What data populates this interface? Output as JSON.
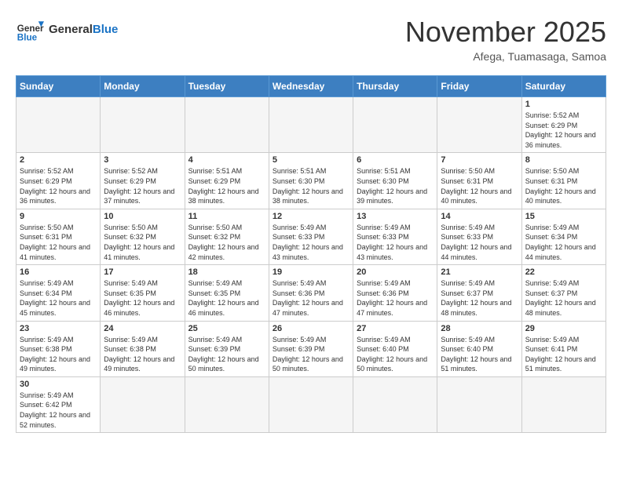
{
  "header": {
    "logo_general": "General",
    "logo_blue": "Blue",
    "month_title": "November 2025",
    "location": "Afega, Tuamasaga, Samoa"
  },
  "weekdays": [
    "Sunday",
    "Monday",
    "Tuesday",
    "Wednesday",
    "Thursday",
    "Friday",
    "Saturday"
  ],
  "weeks": [
    [
      {
        "day": "",
        "empty": true
      },
      {
        "day": "",
        "empty": true
      },
      {
        "day": "",
        "empty": true
      },
      {
        "day": "",
        "empty": true
      },
      {
        "day": "",
        "empty": true
      },
      {
        "day": "",
        "empty": true
      },
      {
        "day": "1",
        "sunrise": "5:52 AM",
        "sunset": "6:29 PM",
        "daylight": "12 hours and 36 minutes."
      }
    ],
    [
      {
        "day": "2",
        "sunrise": "5:52 AM",
        "sunset": "6:29 PM",
        "daylight": "12 hours and 36 minutes."
      },
      {
        "day": "3",
        "sunrise": "5:52 AM",
        "sunset": "6:29 PM",
        "daylight": "12 hours and 37 minutes."
      },
      {
        "day": "4",
        "sunrise": "5:51 AM",
        "sunset": "6:29 PM",
        "daylight": "12 hours and 38 minutes."
      },
      {
        "day": "5",
        "sunrise": "5:51 AM",
        "sunset": "6:30 PM",
        "daylight": "12 hours and 38 minutes."
      },
      {
        "day": "6",
        "sunrise": "5:51 AM",
        "sunset": "6:30 PM",
        "daylight": "12 hours and 39 minutes."
      },
      {
        "day": "7",
        "sunrise": "5:50 AM",
        "sunset": "6:31 PM",
        "daylight": "12 hours and 40 minutes."
      },
      {
        "day": "8",
        "sunrise": "5:50 AM",
        "sunset": "6:31 PM",
        "daylight": "12 hours and 40 minutes."
      }
    ],
    [
      {
        "day": "9",
        "sunrise": "5:50 AM",
        "sunset": "6:31 PM",
        "daylight": "12 hours and 41 minutes."
      },
      {
        "day": "10",
        "sunrise": "5:50 AM",
        "sunset": "6:32 PM",
        "daylight": "12 hours and 41 minutes."
      },
      {
        "day": "11",
        "sunrise": "5:50 AM",
        "sunset": "6:32 PM",
        "daylight": "12 hours and 42 minutes."
      },
      {
        "day": "12",
        "sunrise": "5:49 AM",
        "sunset": "6:33 PM",
        "daylight": "12 hours and 43 minutes."
      },
      {
        "day": "13",
        "sunrise": "5:49 AM",
        "sunset": "6:33 PM",
        "daylight": "12 hours and 43 minutes."
      },
      {
        "day": "14",
        "sunrise": "5:49 AM",
        "sunset": "6:33 PM",
        "daylight": "12 hours and 44 minutes."
      },
      {
        "day": "15",
        "sunrise": "5:49 AM",
        "sunset": "6:34 PM",
        "daylight": "12 hours and 44 minutes."
      }
    ],
    [
      {
        "day": "16",
        "sunrise": "5:49 AM",
        "sunset": "6:34 PM",
        "daylight": "12 hours and 45 minutes."
      },
      {
        "day": "17",
        "sunrise": "5:49 AM",
        "sunset": "6:35 PM",
        "daylight": "12 hours and 46 minutes."
      },
      {
        "day": "18",
        "sunrise": "5:49 AM",
        "sunset": "6:35 PM",
        "daylight": "12 hours and 46 minutes."
      },
      {
        "day": "19",
        "sunrise": "5:49 AM",
        "sunset": "6:36 PM",
        "daylight": "12 hours and 47 minutes."
      },
      {
        "day": "20",
        "sunrise": "5:49 AM",
        "sunset": "6:36 PM",
        "daylight": "12 hours and 47 minutes."
      },
      {
        "day": "21",
        "sunrise": "5:49 AM",
        "sunset": "6:37 PM",
        "daylight": "12 hours and 48 minutes."
      },
      {
        "day": "22",
        "sunrise": "5:49 AM",
        "sunset": "6:37 PM",
        "daylight": "12 hours and 48 minutes."
      }
    ],
    [
      {
        "day": "23",
        "sunrise": "5:49 AM",
        "sunset": "6:38 PM",
        "daylight": "12 hours and 49 minutes."
      },
      {
        "day": "24",
        "sunrise": "5:49 AM",
        "sunset": "6:38 PM",
        "daylight": "12 hours and 49 minutes."
      },
      {
        "day": "25",
        "sunrise": "5:49 AM",
        "sunset": "6:39 PM",
        "daylight": "12 hours and 50 minutes."
      },
      {
        "day": "26",
        "sunrise": "5:49 AM",
        "sunset": "6:39 PM",
        "daylight": "12 hours and 50 minutes."
      },
      {
        "day": "27",
        "sunrise": "5:49 AM",
        "sunset": "6:40 PM",
        "daylight": "12 hours and 50 minutes."
      },
      {
        "day": "28",
        "sunrise": "5:49 AM",
        "sunset": "6:40 PM",
        "daylight": "12 hours and 51 minutes."
      },
      {
        "day": "29",
        "sunrise": "5:49 AM",
        "sunset": "6:41 PM",
        "daylight": "12 hours and 51 minutes."
      }
    ],
    [
      {
        "day": "30",
        "sunrise": "5:49 AM",
        "sunset": "6:42 PM",
        "daylight": "12 hours and 52 minutes."
      },
      {
        "day": "",
        "empty": true
      },
      {
        "day": "",
        "empty": true
      },
      {
        "day": "",
        "empty": true
      },
      {
        "day": "",
        "empty": true
      },
      {
        "day": "",
        "empty": true
      },
      {
        "day": "",
        "empty": true
      }
    ]
  ]
}
